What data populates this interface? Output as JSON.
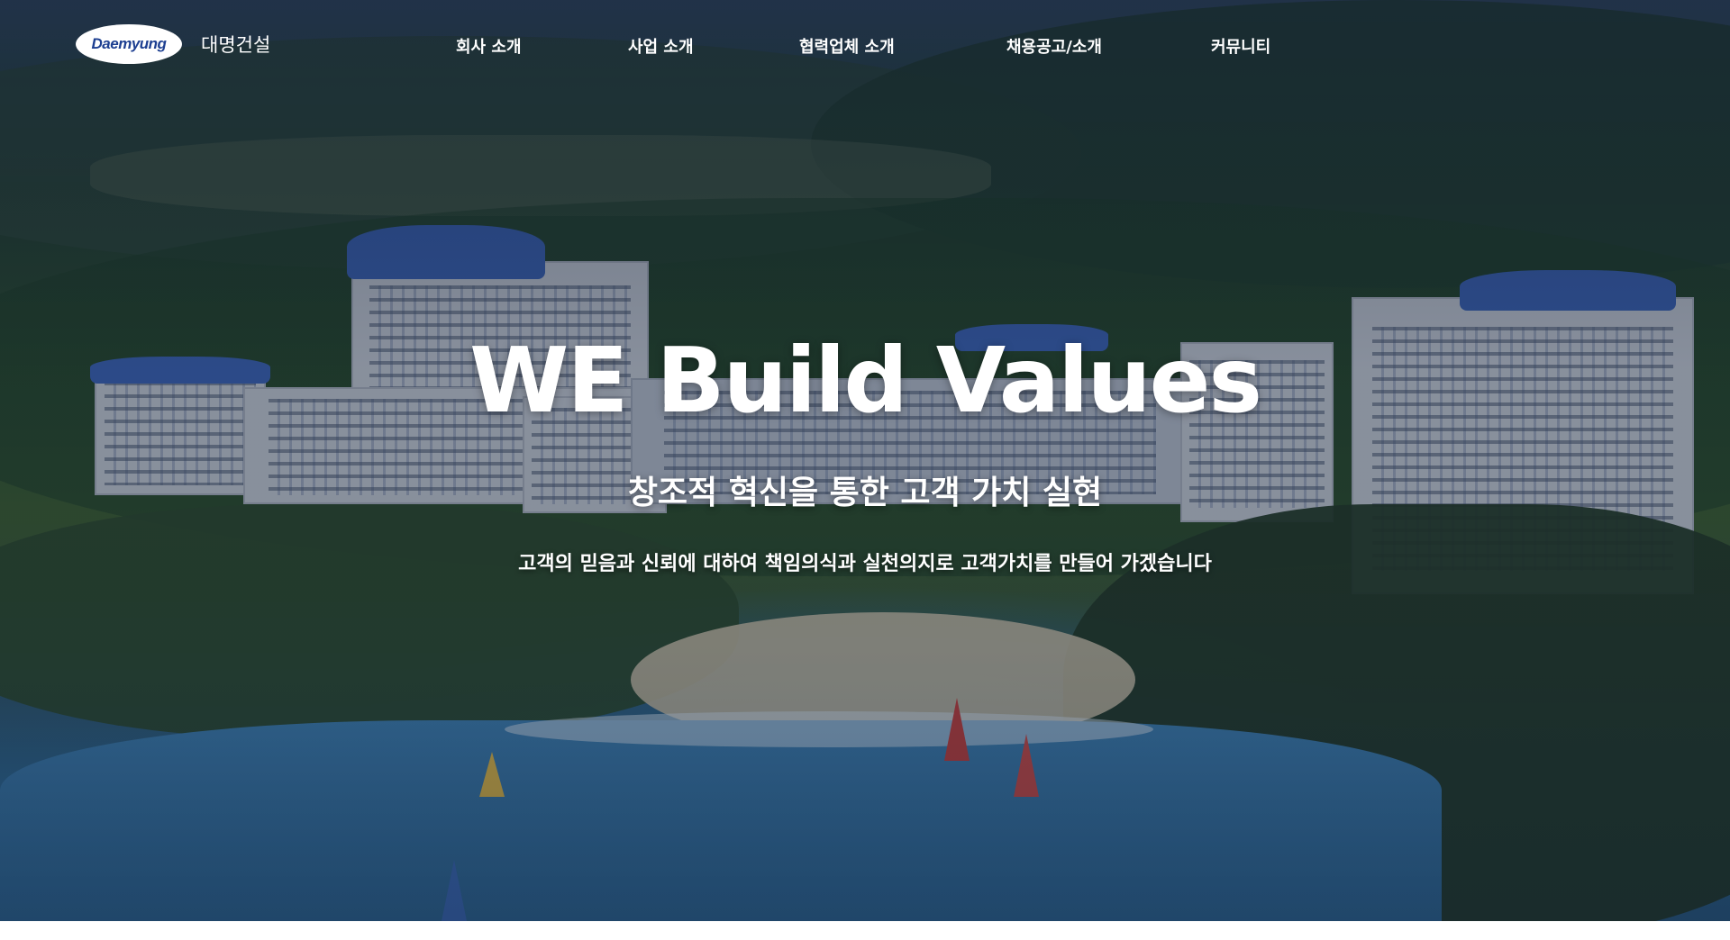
{
  "brand": {
    "logo_text": "Daemyung",
    "name": "대명건설"
  },
  "nav": {
    "items": [
      {
        "label": "회사 소개"
      },
      {
        "label": "사업 소개"
      },
      {
        "label": "협력업체 소개"
      },
      {
        "label": "채용공고/소개"
      },
      {
        "label": "커뮤니티"
      }
    ]
  },
  "hero": {
    "headline": "WE Build Values",
    "subheadline": "창조적 혁신을 통한 고객 가치 실현",
    "tagline": "고객의 믿음과 신뢰에 대하여 책임의식과 실천의지로 고객가치를 만들어 가겠습니다"
  },
  "colors": {
    "text": "#ffffff",
    "logo_text": "#1d3f91",
    "roof_blue": "#3b64b8"
  }
}
